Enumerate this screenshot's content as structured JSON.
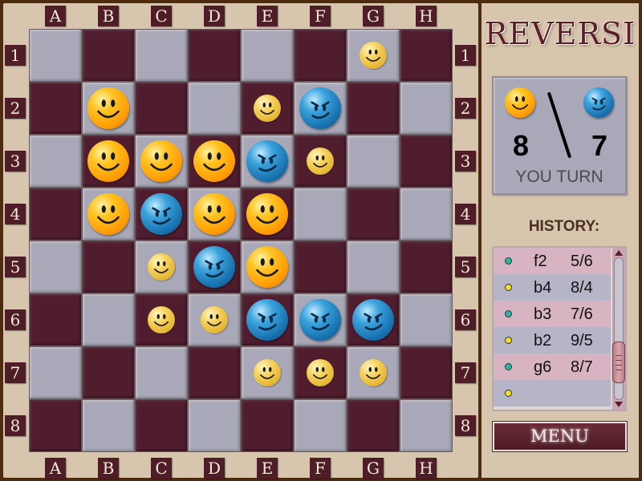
{
  "app_title": "REVERSI",
  "columns": [
    "A",
    "B",
    "C",
    "D",
    "E",
    "F",
    "G",
    "H"
  ],
  "rows": [
    "1",
    "2",
    "3",
    "4",
    "5",
    "6",
    "7",
    "8"
  ],
  "colors": {
    "light_square": "#a9a8b8",
    "dark_square": "#4f1d2e",
    "player_disc": "#ff9a05",
    "opponent_disc": "#1670ad",
    "accent": "#5b1e27"
  },
  "board": {
    "pieces": [
      {
        "cell": "B2",
        "type": "orange"
      },
      {
        "cell": "F2",
        "type": "blue"
      },
      {
        "cell": "B3",
        "type": "orange"
      },
      {
        "cell": "C3",
        "type": "orange"
      },
      {
        "cell": "D3",
        "type": "orange"
      },
      {
        "cell": "E3",
        "type": "blue"
      },
      {
        "cell": "B4",
        "type": "orange"
      },
      {
        "cell": "C4",
        "type": "blue"
      },
      {
        "cell": "D4",
        "type": "orange"
      },
      {
        "cell": "E4",
        "type": "orange"
      },
      {
        "cell": "D5",
        "type": "blue"
      },
      {
        "cell": "E5",
        "type": "orange"
      },
      {
        "cell": "E6",
        "type": "blue"
      },
      {
        "cell": "F6",
        "type": "blue"
      },
      {
        "cell": "G6",
        "type": "blue"
      }
    ],
    "hints": [
      "G1",
      "E2",
      "F3",
      "C5",
      "C6",
      "D6",
      "E7",
      "F7",
      "G7"
    ]
  },
  "score": {
    "player_icon": "orange-smiley-icon",
    "opponent_icon": "blue-smiley-icon",
    "player_count": "8",
    "opponent_count": "7",
    "turn_label": "YOU TURN"
  },
  "history": {
    "title": "HISTORY:",
    "items": [
      {
        "player": "blue",
        "move": "f2",
        "score": "5/6"
      },
      {
        "player": "orange",
        "move": "b4",
        "score": "8/4"
      },
      {
        "player": "blue",
        "move": "b3",
        "score": "7/6"
      },
      {
        "player": "orange",
        "move": "b2",
        "score": "9/5"
      },
      {
        "player": "blue",
        "move": "g6",
        "score": "8/7"
      },
      {
        "player": "orange",
        "move": "",
        "score": ""
      }
    ]
  },
  "menu_label": "MENU"
}
